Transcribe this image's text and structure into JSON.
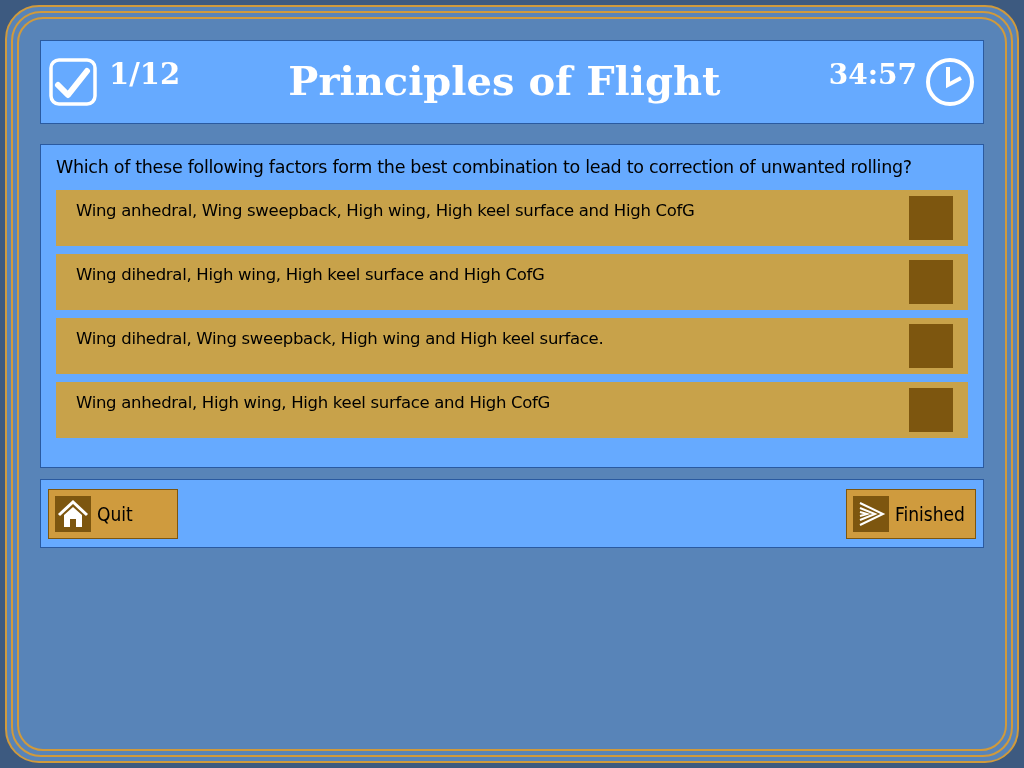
{
  "header": {
    "progress": "1/12",
    "title": "Principles of Flight",
    "timer": "34:57"
  },
  "question": {
    "text": "Which of these following factors form the best combination to lead to correction of unwanted rolling?",
    "options": [
      {
        "text": "Wing anhedral, Wing sweepback, High wing, High keel surface and High CofG",
        "selected": false
      },
      {
        "text": "Wing dihedral, High wing, High keel surface and High CofG",
        "selected": false
      },
      {
        "text": "Wing dihedral, Wing sweepback, High wing and High keel surface.",
        "selected": false
      },
      {
        "text": "Wing anhedral, High wing, High keel surface and High CofG",
        "selected": false
      }
    ]
  },
  "footer": {
    "buttons": [
      {
        "kind": "home",
        "label": "Quit"
      },
      {
        "kind": "next",
        "label": "Finished"
      }
    ]
  }
}
